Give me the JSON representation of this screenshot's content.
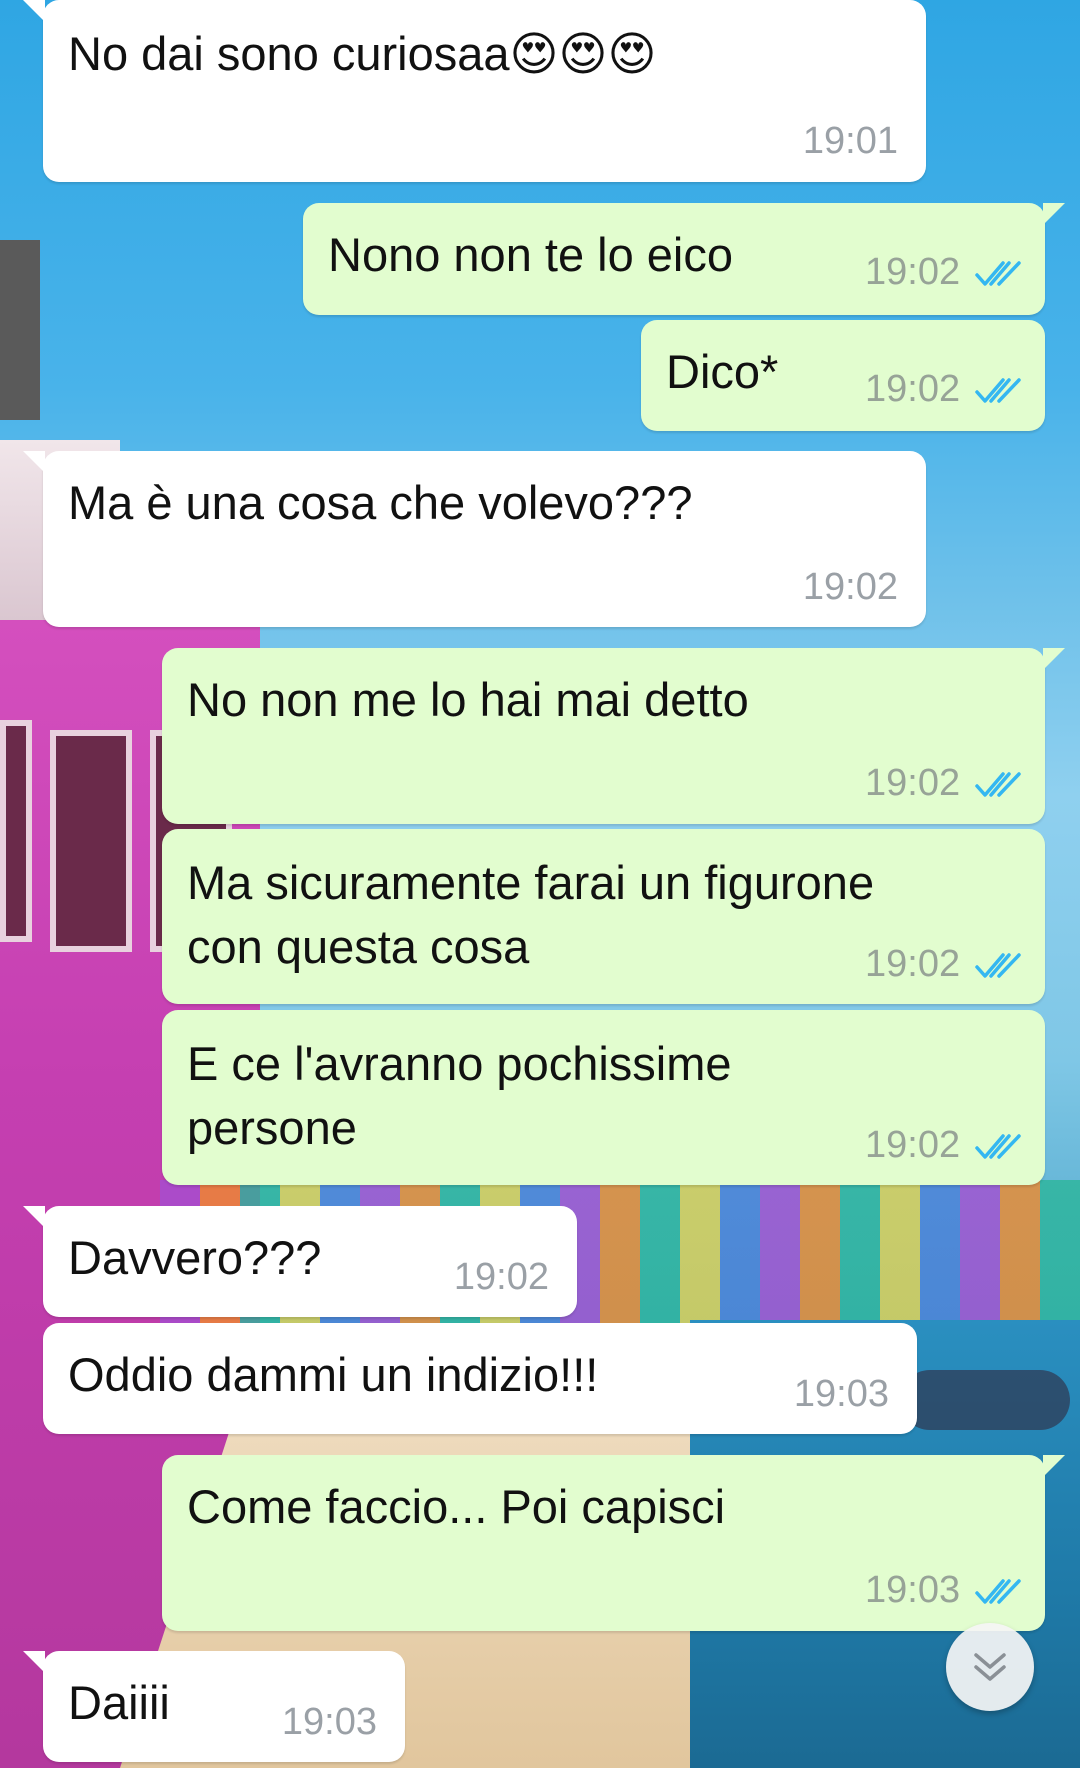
{
  "messages": [
    {
      "direction": "incoming",
      "text": "No dai sono curiosaa😍😍😍",
      "time": "19:01"
    },
    {
      "direction": "outgoing",
      "text": "Nono non te lo eico",
      "time": "19:02",
      "status": "read"
    },
    {
      "direction": "outgoing",
      "text": "Dico*",
      "time": "19:02",
      "status": "read"
    },
    {
      "direction": "incoming",
      "text": "Ma è una cosa che volevo???",
      "time": "19:02"
    },
    {
      "direction": "outgoing",
      "text": "No non me lo hai mai detto",
      "time": "19:02",
      "status": "read"
    },
    {
      "direction": "outgoing",
      "text": "Ma sicuramente farai un figurone\ncon questa cosa",
      "time": "19:02",
      "status": "read"
    },
    {
      "direction": "outgoing",
      "text": "E ce l'avranno pochissime\npersone",
      "time": "19:02",
      "status": "read"
    },
    {
      "direction": "incoming",
      "text": "Davvero???",
      "time": "19:02"
    },
    {
      "direction": "incoming",
      "text": "Oddio dammi un indizio!!!",
      "time": "19:03"
    },
    {
      "direction": "outgoing",
      "text": "Come faccio... Poi capisci",
      "time": "19:03",
      "status": "read"
    },
    {
      "direction": "incoming",
      "text": "Daiiii",
      "time": "19:03"
    }
  ],
  "icons": {
    "read_receipt": "double-check-icon",
    "scroll_down": "chevron-double-down-icon"
  },
  "colors": {
    "incoming_bubble": "#ffffff",
    "outgoing_bubble": "#e2fdcf",
    "read_tick": "#34b7f1"
  }
}
